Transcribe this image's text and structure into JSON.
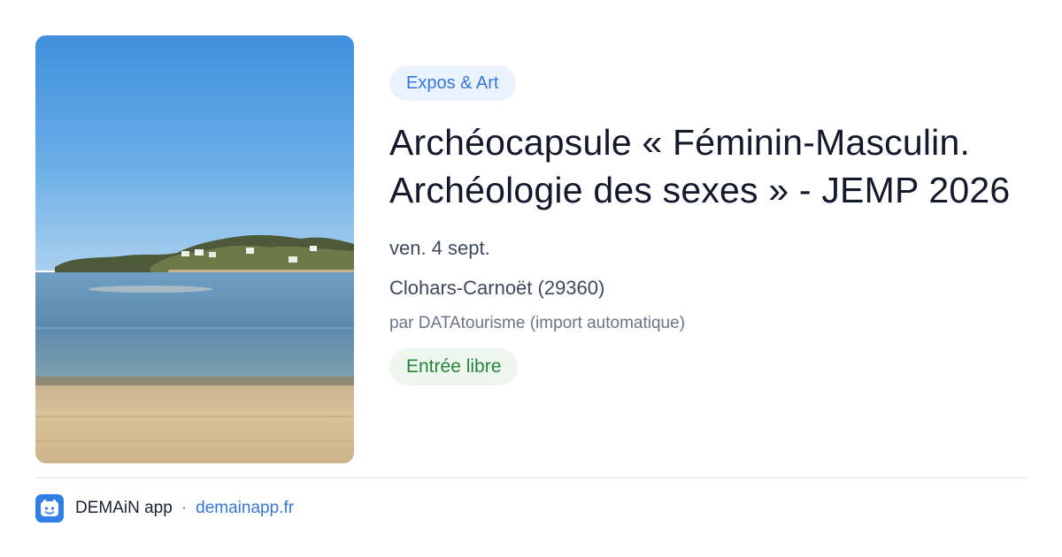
{
  "event": {
    "category": "Expos & Art",
    "title": "Archéocapsule « Féminin-Masculin. Archéologie des sexes » - JEMP 2026",
    "date": "ven. 4 sept.",
    "location": "Clohars-Carnoët (29360)",
    "source": "par DATAtourisme (import automatique)",
    "price": "Entrée libre"
  },
  "footer": {
    "app_name": "DEMAiN app",
    "separator": "·",
    "domain": "demainapp.fr",
    "icon": "demain-app-logo-icon"
  },
  "colors": {
    "accent": "#3578d8",
    "chip_category_bg": "#eaf2fe",
    "chip_price_bg": "#edf7ee",
    "chip_price_text": "#26843c",
    "title": "#14192b"
  }
}
